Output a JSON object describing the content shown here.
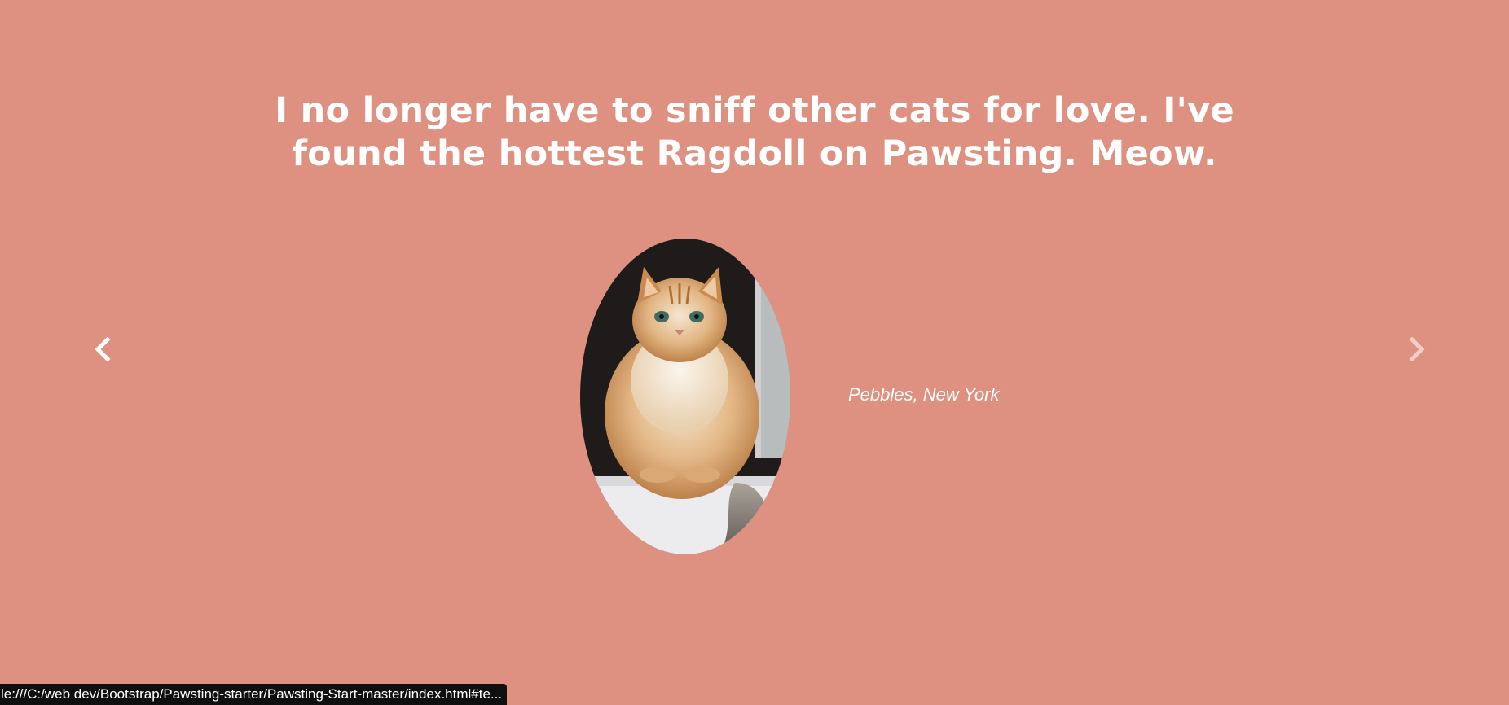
{
  "testimonial": {
    "quote": "I no longer have to sniff other cats for love. I've found the hottest Ragdoll on Pawsting. Meow.",
    "author": "Pebbles, New York",
    "image_description_icon": "cat-photo"
  },
  "carousel": {
    "prev_icon": "chevron-left-icon",
    "next_icon": "chevron-right-icon"
  },
  "status_bar": {
    "url": "le:///C:/web dev/Bootstrap/Pawsting-starter/Pawsting-Start-master/index.html#te..."
  },
  "colors": {
    "background": "#de9180",
    "text": "#ffffff",
    "status_bar_bg": "#0f0f0f"
  }
}
